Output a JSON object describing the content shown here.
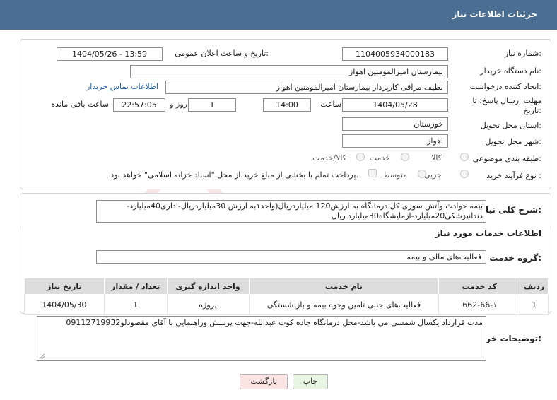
{
  "header": {
    "title": "جزئیات اطلاعات نیاز"
  },
  "fields": {
    "need_number_label": "شماره نیاز:",
    "need_number": "1104005934000183",
    "announce_label": "تاریخ و ساعت اعلان عمومی:",
    "announce_value": "1404/05/26 - 13:59",
    "buyer_org_label": "نام دستگاه خریدار:",
    "buyer_org": "بیمارستان امیرالمومنین اهواز",
    "creator_label": "ایجاد کننده درخواست:",
    "creator": "لطیف مراقی کارپرداز بیمارستان امیرالمومنین اهواز",
    "contact_link": "اطلاعات تماس خریدار",
    "deadline_label_line1": "مهلت ارسال پاسخ: تا",
    "deadline_label_line2": "تاریخ:",
    "deadline_date": "1404/05/28",
    "time_label": "ساعت",
    "deadline_time": "14:00",
    "days_value": "1",
    "days_label": "روز و",
    "remaining_time": "22:57:05",
    "remaining_label": "ساعت باقی مانده",
    "province_label": "استان محل تحویل:",
    "province": "خوزستان",
    "city_label": "شهر محل تحویل:",
    "city": "اهواز",
    "category_label": "طبقه بندی موضوعی:",
    "category_options": [
      "کالا",
      "خدمت",
      "کالا/خدمت"
    ],
    "process_label": "نوع فرآیند خرید :",
    "process_options": [
      "جزیی",
      "متوسط"
    ],
    "payment_note": "پرداخت تمام یا بخشی از مبلغ خرید،از محل \"اسناد خزانه اسلامی\" خواهد بود."
  },
  "description": {
    "label": "شرح کلی نیاز:",
    "text": "بیمه حوادث وآتش سوزی کل درمانگاه به ارزش120 میلیاردریال(واحد۱به ارزش 30میلیاردریال-اداری40میلیارد-دندانپزشکی20میلیارد-ازمایشگاه30میلیارد ریال"
  },
  "services": {
    "section_title": "اطلاعات خدمات مورد نیاز",
    "group_label": "گروه خدمت:",
    "group_value": "فعالیت‌های مالی و بیمه",
    "columns": [
      "ردیف",
      "کد خدمت",
      "نام خدمت",
      "واحد اندازه گیری",
      "تعداد / مقدار",
      "تاریخ نیاز"
    ],
    "rows": [
      {
        "row": "1",
        "code": "ذ-66-662",
        "name": "فعالیت‌های جنبی تامین وجوه بیمه و بازنشستگی",
        "unit": "پروژه",
        "qty": "1",
        "date": "1404/05/30"
      }
    ]
  },
  "buyer_notes": {
    "label": "توضیحات خریدار:",
    "text": "مدت قرارداد یکسال شمسی می باشد-محل درمانگاه جاده کوت عبدالله-جهت پرسش وراهنمایی با آقای مقصودلو09112719932"
  },
  "buttons": {
    "print": "چاپ",
    "back": "بازگشت"
  },
  "colors": {
    "header_bg": "#4a6f93",
    "link": "#1f5fa8",
    "print_btn_bg": "#e9f5e3",
    "back_btn_bg": "#fbe4e4"
  }
}
